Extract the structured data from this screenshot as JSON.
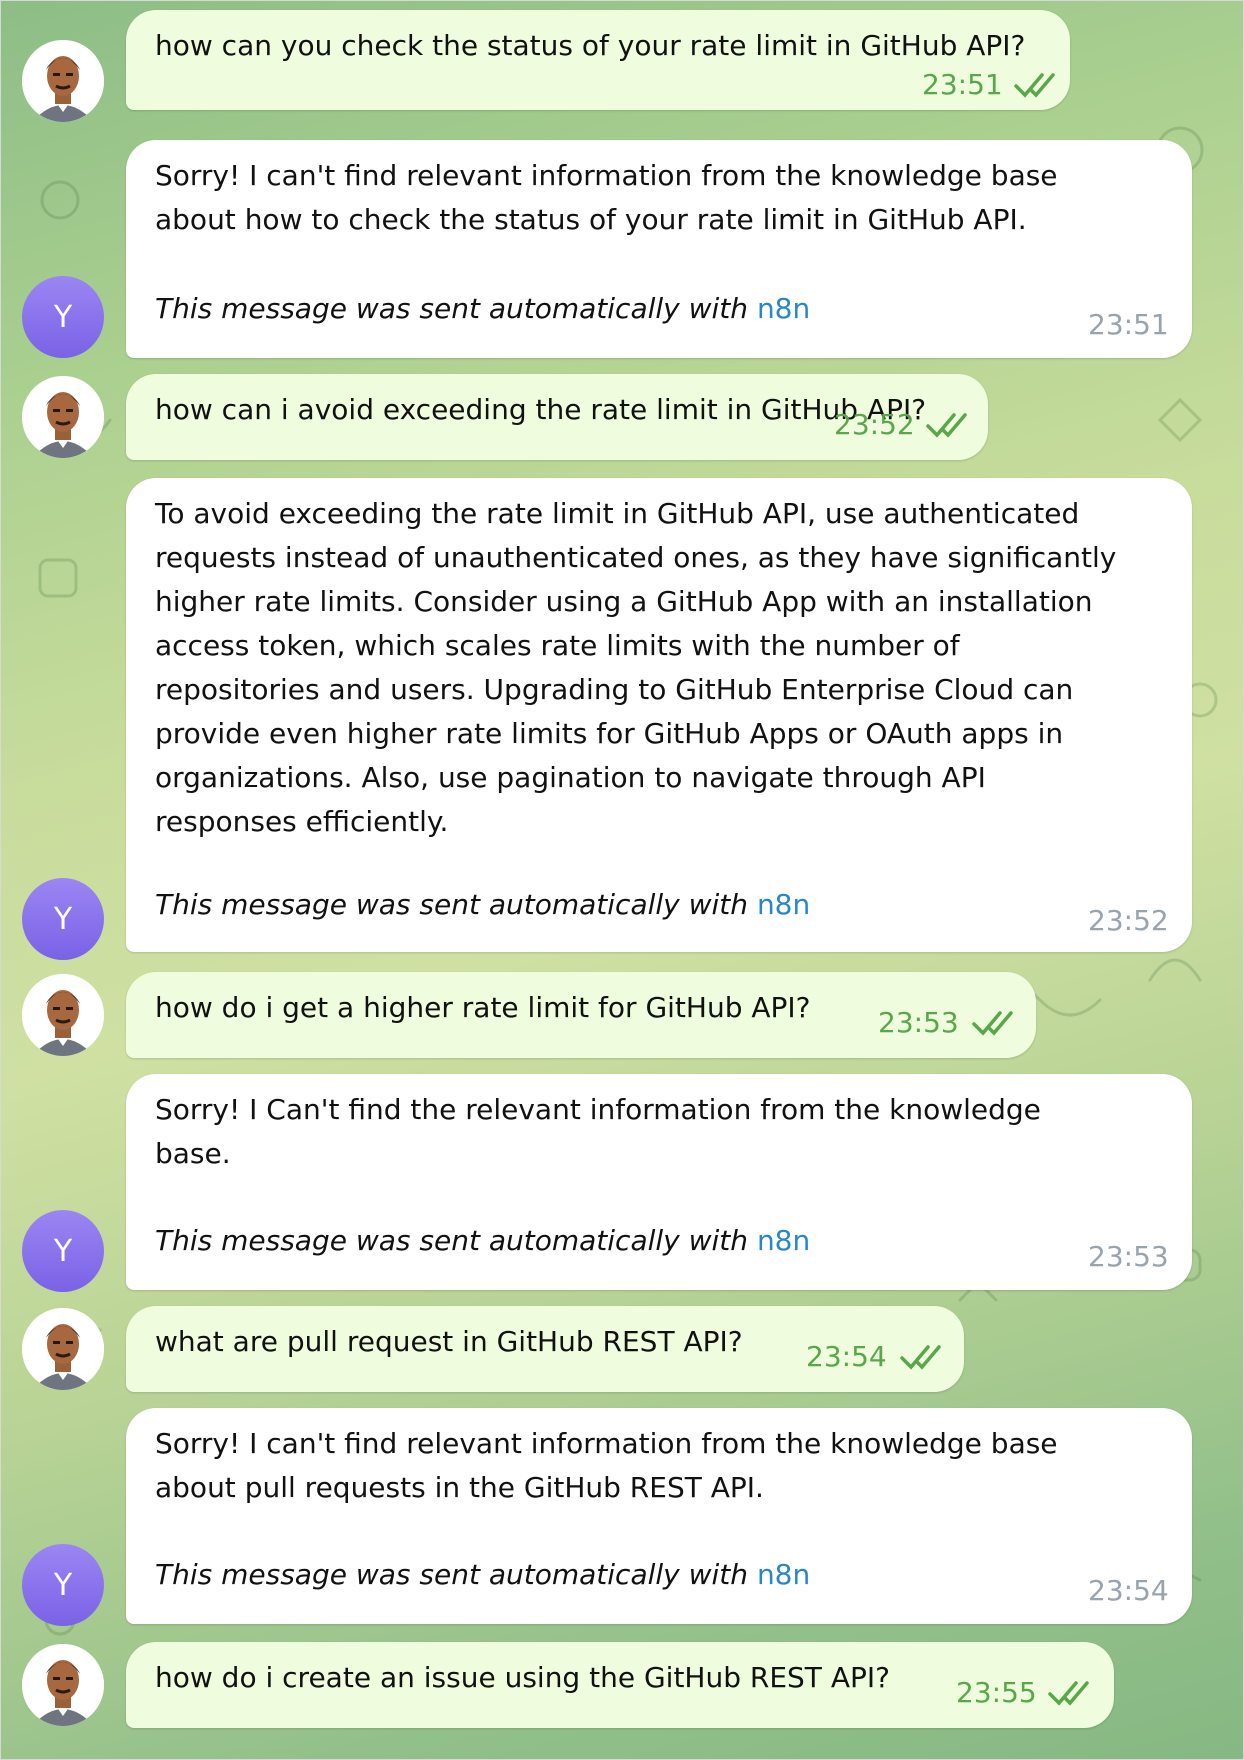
{
  "theme": {
    "out_bubble": "#effdde",
    "in_bubble": "#ffffff",
    "out_time": "#5aa64a",
    "in_time": "#98a3ad",
    "link": "#2b86c9",
    "bot_avatar": "#8a73ee"
  },
  "bot": {
    "avatar_letter": "Y"
  },
  "messages": [
    {
      "id": "m1",
      "direction": "outgoing",
      "lines": [
        "how can you check the status of your rate limit in GitHub API?"
      ],
      "time": "23:51",
      "status": "read"
    },
    {
      "id": "m2",
      "direction": "incoming",
      "lines": [
        "Sorry! I can't find relevant information from the knowledge base",
        "about how to check the status of your rate limit in GitHub API."
      ],
      "footer_text": "This message was sent automatically with",
      "footer_link": "n8n",
      "time": "23:51"
    },
    {
      "id": "m3",
      "direction": "outgoing",
      "lines": [
        "how can i avoid exceeding the rate limit in GitHub API?"
      ],
      "time": "23:52",
      "status": "read"
    },
    {
      "id": "m4",
      "direction": "incoming",
      "lines": [
        "To avoid exceeding the rate limit in GitHub API, use authenticated",
        "requests instead of unauthenticated ones, as they have significantly",
        "higher rate limits. Consider using a GitHub App with an installation",
        "access token, which scales rate limits with the number of",
        "repositories and users. Upgrading to GitHub Enterprise Cloud can",
        "provide even higher rate limits for GitHub Apps or OAuth apps in",
        "organizations. Also, use pagination to navigate through API",
        "responses efficiently."
      ],
      "footer_text": "This message was sent automatically with",
      "footer_link": "n8n",
      "time": "23:52"
    },
    {
      "id": "m5",
      "direction": "outgoing",
      "lines": [
        "how do i get a higher rate limit for GitHub API?"
      ],
      "time": "23:53",
      "status": "read"
    },
    {
      "id": "m6",
      "direction": "incoming",
      "lines": [
        "Sorry! I Can't find the relevant information from the knowledge",
        "base."
      ],
      "footer_text": "This message was sent automatically with",
      "footer_link": "n8n",
      "time": "23:53"
    },
    {
      "id": "m7",
      "direction": "outgoing",
      "lines": [
        "what are pull request in GitHub REST API?"
      ],
      "time": "23:54",
      "status": "read"
    },
    {
      "id": "m8",
      "direction": "incoming",
      "lines": [
        "Sorry! I can't find relevant information from the knowledge base",
        "about pull requests in the GitHub REST API."
      ],
      "footer_text": "This message was sent automatically with",
      "footer_link": "n8n",
      "time": "23:54"
    },
    {
      "id": "m9",
      "direction": "outgoing",
      "lines": [
        "how do i create an issue using the GitHub REST API?"
      ],
      "time": "23:55",
      "status": "read"
    }
  ]
}
